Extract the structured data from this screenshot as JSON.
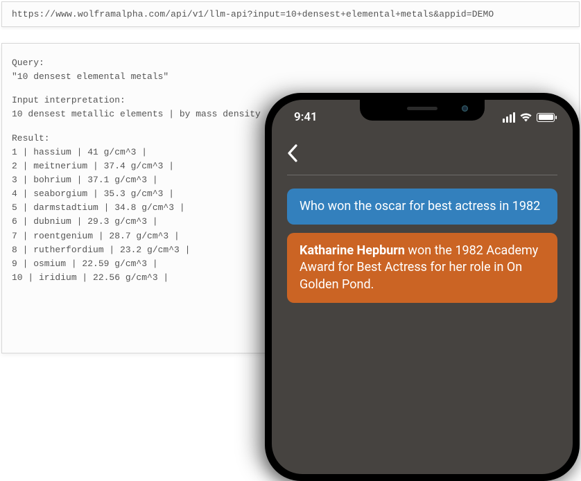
{
  "url_bar": "https://www.wolframalpha.com/api/v1/llm-api?input=10+densest+elemental+metals&appid=DEMO",
  "api_output": {
    "query_label": "Query:",
    "query_value": "\"10 densest elemental metals\"",
    "interp_label": "Input interpretation:",
    "interp_value": "10 densest metallic elements | by mass density",
    "result_label": "Result:",
    "rows": [
      {
        "n": "1",
        "name": "hassium",
        "density": "41 g/cm^3"
      },
      {
        "n": "2",
        "name": "meitnerium",
        "density": "37.4 g/cm^3"
      },
      {
        "n": "3",
        "name": "bohrium",
        "density": "37.1 g/cm^3"
      },
      {
        "n": "4",
        "name": "seaborgium",
        "density": "35.3 g/cm^3"
      },
      {
        "n": "5",
        "name": "darmstadtium",
        "density": "34.8 g/cm^3"
      },
      {
        "n": "6",
        "name": "dubnium",
        "density": "29.3 g/cm^3"
      },
      {
        "n": "7",
        "name": "roentgenium",
        "density": "28.7 g/cm^3"
      },
      {
        "n": "8",
        "name": "rutherfordium",
        "density": "23.2 g/cm^3"
      },
      {
        "n": "9",
        "name": "osmium",
        "density": "22.59 g/cm^3"
      },
      {
        "n": "10",
        "name": "iridium",
        "density": "22.56 g/cm^3"
      }
    ]
  },
  "phone": {
    "time": "9:41",
    "chat": {
      "user_msg": "Who won the oscar for best actress in 1982",
      "bot_msg_strong": "Katharine Hepburn",
      "bot_msg_rest": " won the 1982 Academy Award for Best Actress for her role in On Golden Pond."
    }
  }
}
